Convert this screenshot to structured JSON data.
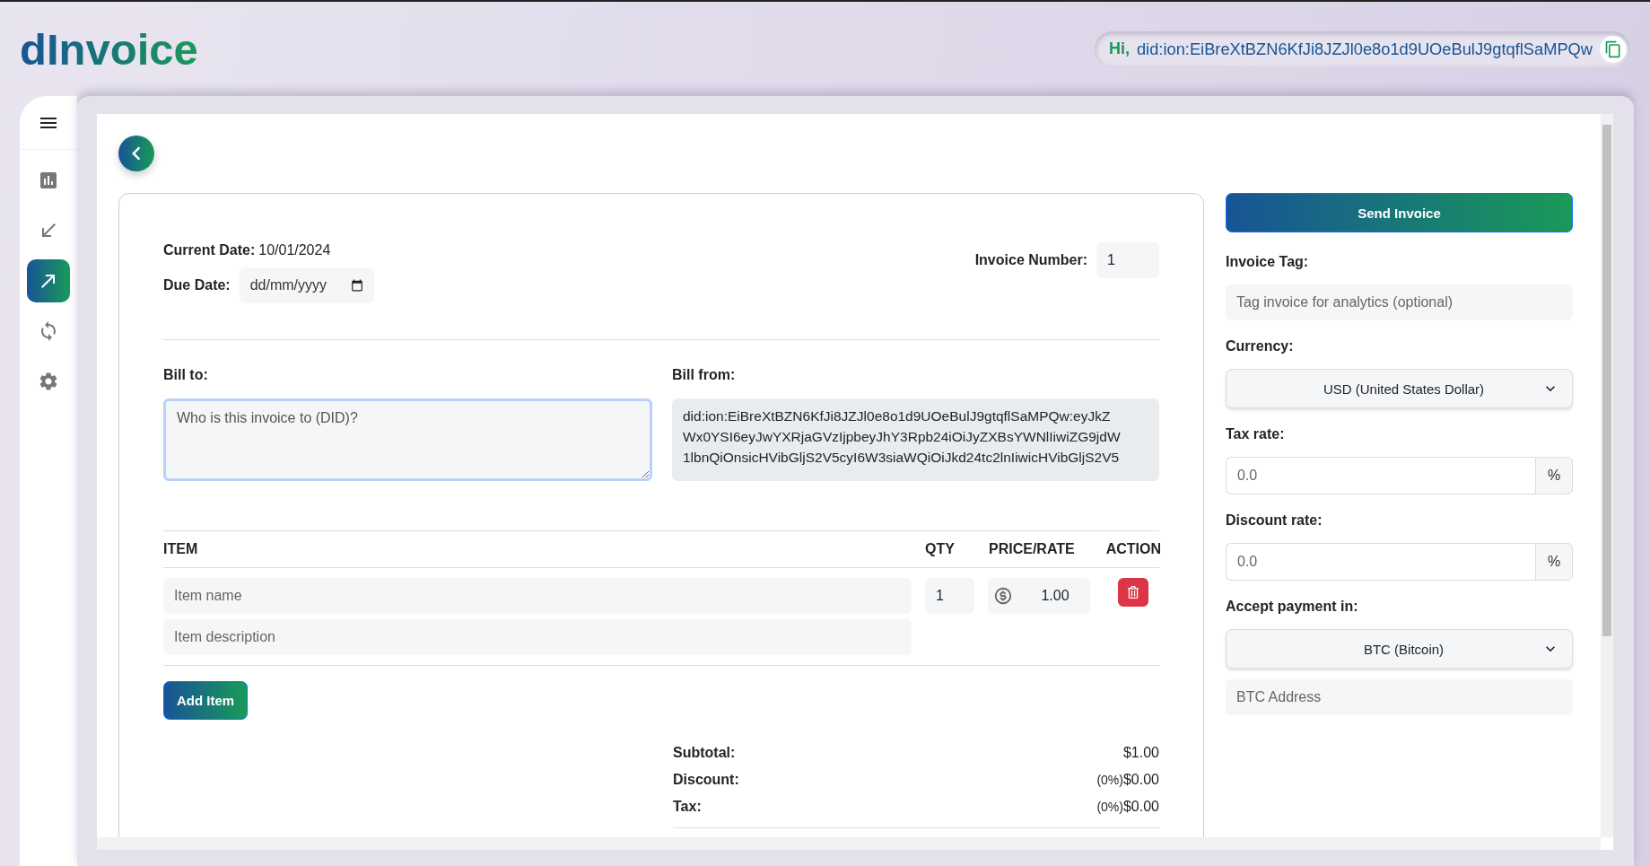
{
  "header": {
    "logo": "dInvoice",
    "greeting": "Hi,",
    "did": "did:ion:EiBreXtBZN6KfJi8JZJl0e8o1d9UOeBulJ9gtqflSaMPQw"
  },
  "sidebar": {
    "items": [
      {
        "kind": "chart",
        "selected": false
      },
      {
        "kind": "incoming",
        "selected": false
      },
      {
        "kind": "outgoing",
        "selected": true
      },
      {
        "kind": "sync",
        "selected": false
      },
      {
        "kind": "settings",
        "selected": false
      }
    ]
  },
  "form": {
    "current_date": {
      "label": "Current Date:",
      "value": "10/01/2024"
    },
    "due_date": {
      "label": "Due Date:",
      "placeholder": "dd/mm/yyyy"
    },
    "invoice_number": {
      "label": "Invoice Number:",
      "value": "1"
    },
    "bill_to": {
      "label": "Bill to:",
      "placeholder": "Who is this invoice to (DID)?",
      "focused": true
    },
    "bill_from": {
      "label": "Bill from:",
      "lines": [
        "did:ion:EiBreXtBZN6KfJi8JZJl0e8o1d9UOeBulJ9gtqflSaMPQw:eyJkZ",
        "Wx0YSI6eyJwYXRjaGVzIjpbeyJhY3Rpb24iOiJyZXBsYWNlIiwiZG9jdW",
        "1lbnQiOnsicHVibGljS2V5cyI6W3siaWQiOiJkd24tc2lnIiwicHVibGljS2V5"
      ]
    },
    "columns": [
      "ITEM",
      "QTY",
      "PRICE/RATE",
      "ACTION"
    ],
    "rows": [
      {
        "name_placeholder": "Item name",
        "description_placeholder": "Item description",
        "qty": "1",
        "price": "1.00"
      }
    ],
    "add_item": "Add Item",
    "totals": [
      {
        "label": "Subtotal:",
        "value": "$1.00"
      },
      {
        "label": "Discount:",
        "note": "(0%)",
        "value": "$0.00"
      },
      {
        "label": "Tax:",
        "note": "(0%)",
        "value": "$0.00"
      }
    ]
  },
  "settings": {
    "send": "Send Invoice",
    "fields": [
      {
        "kind": "text",
        "label": "Invoice Tag:",
        "placeholder": "Tag invoice for analytics (optional)"
      },
      {
        "kind": "select",
        "label": "Currency:",
        "value": "USD (United States Dollar)"
      },
      {
        "kind": "percent",
        "label": "Tax rate:",
        "placeholder": "0.0",
        "suffix": "%"
      },
      {
        "kind": "percent",
        "label": "Discount rate:",
        "placeholder": "0.0",
        "suffix": "%"
      },
      {
        "kind": "select",
        "label": "Accept payment in:",
        "value": "BTC (Bitcoin)"
      },
      {
        "kind": "text",
        "placeholder": "BTC Address"
      }
    ]
  }
}
